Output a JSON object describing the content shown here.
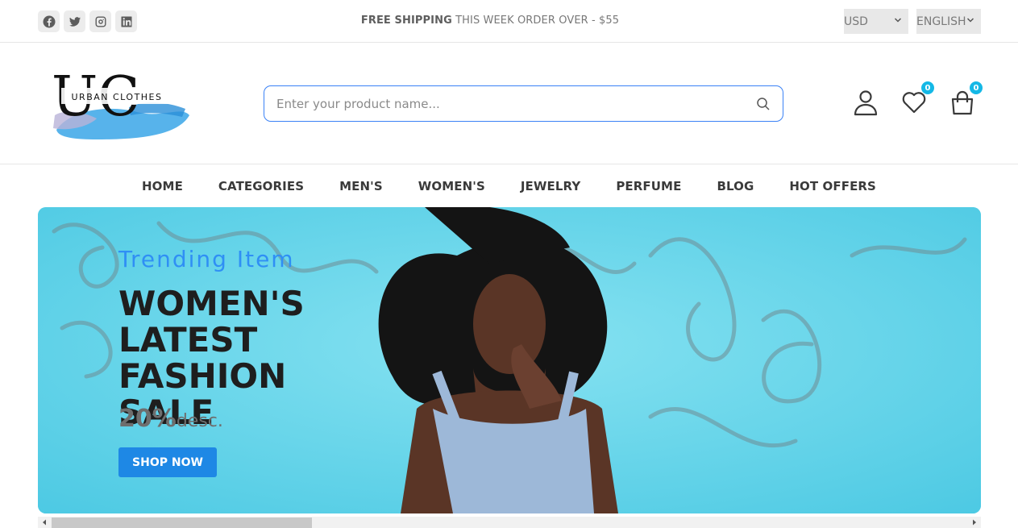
{
  "topbar": {
    "social_icons": [
      "facebook-icon",
      "twitter-icon",
      "instagram-icon",
      "linkedin-icon"
    ],
    "promo_bold": "FREE SHIPPING",
    "promo_rest": " THIS WEEK ORDER OVER - $55",
    "currency": "USD",
    "language": "ENGLISH"
  },
  "header": {
    "logo_text": "URBAN CLOTHES",
    "logo_letters": "UC",
    "search_placeholder": "Enter your product name...",
    "wishlist_count": "0",
    "cart_count": "0"
  },
  "nav": {
    "items": [
      "HOME",
      "CATEGORIES",
      "MEN'S",
      "WOMEN'S",
      "JEWELRY",
      "PERFUME",
      "BLOG",
      "HOT OFFERS"
    ]
  },
  "banner": {
    "subtitle": "Trending Item",
    "title": "WOMEN'S LATEST FASHION SALE",
    "discount_value": "20%",
    "discount_label": "desc.",
    "button": "SHOP NOW"
  },
  "colors": {
    "accent_blue": "#1e88e5",
    "subtitle_blue": "#2f8ff5",
    "badge_cyan": "#14b8e6",
    "banner_bg": "#5fd3ea"
  }
}
